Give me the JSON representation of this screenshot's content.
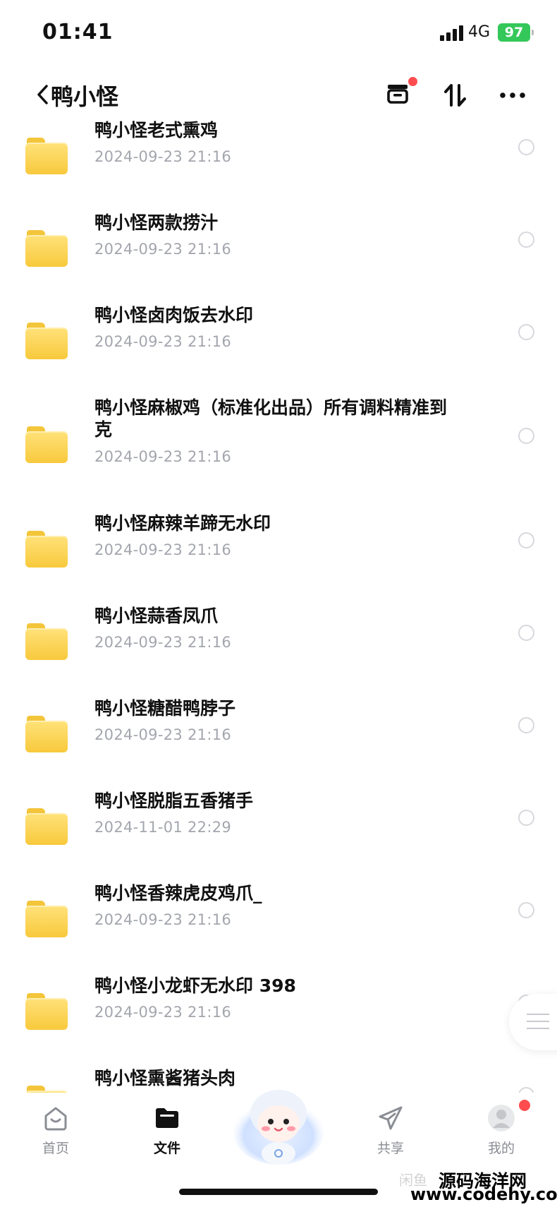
{
  "status_bar": {
    "time": "01:41",
    "network": "4G",
    "battery": "97"
  },
  "header": {
    "title": "鸭小怪"
  },
  "files": [
    {
      "name": "鸭小怪老式熏鸡",
      "date": "2024-09-23 21:16"
    },
    {
      "name": "鸭小怪两款捞汁",
      "date": "2024-09-23 21:16"
    },
    {
      "name": "鸭小怪卤肉饭去水印",
      "date": "2024-09-23 21:16"
    },
    {
      "name": "鸭小怪麻椒鸡（标准化出品）所有调料精准到克",
      "date": "2024-09-23 21:16"
    },
    {
      "name": "鸭小怪麻辣羊蹄无水印",
      "date": "2024-09-23 21:16"
    },
    {
      "name": "鸭小怪蒜香凤爪",
      "date": "2024-09-23 21:16"
    },
    {
      "name": "鸭小怪糖醋鸭脖子",
      "date": "2024-09-23 21:16"
    },
    {
      "name": "鸭小怪脱脂五香猪手",
      "date": "2024-11-01 22:29"
    },
    {
      "name": "鸭小怪香辣虎皮鸡爪_",
      "date": "2024-09-23 21:16"
    },
    {
      "name": "鸭小怪小龙虾无水印 398",
      "date": "2024-09-23 21:16"
    },
    {
      "name": "鸭小怪熏酱猪头肉",
      "date": ""
    }
  ],
  "nav": [
    {
      "label": "首页",
      "icon": "home-icon"
    },
    {
      "label": "文件",
      "icon": "folder-icon"
    },
    {
      "label": "共享",
      "icon": "share-icon"
    },
    {
      "label": "我的",
      "icon": "avatar-icon"
    }
  ],
  "watermark": {
    "faint": "闲鱼",
    "line1": "源码海洋网",
    "line2": "www.codehy.com"
  },
  "colors": {
    "accent": "#f8c93c",
    "text": "#111111",
    "secondary": "#a3a6ad",
    "badge": "#ff4d4f",
    "battery": "#34c759"
  }
}
